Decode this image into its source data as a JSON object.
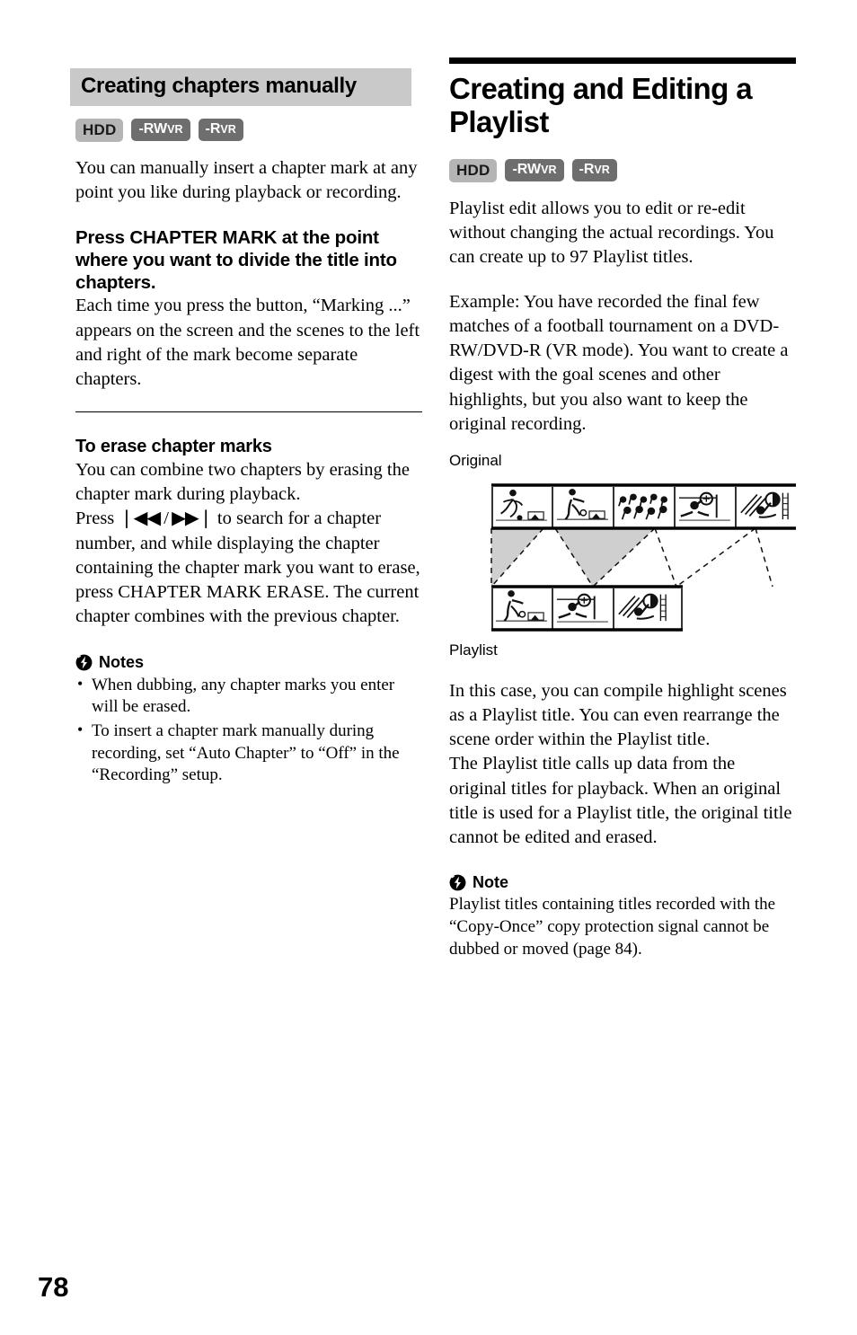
{
  "page": {
    "number": "78"
  },
  "left_column": {
    "section_heading": "Creating chapters manually",
    "badges": [
      {
        "id": "hdd",
        "label": "HDD",
        "style": "light"
      },
      {
        "id": "rwvr",
        "main": "-RW",
        "sub": "VR",
        "style": "dark"
      },
      {
        "id": "rvr",
        "main": "-R",
        "sub": "VR",
        "style": "dark"
      }
    ],
    "intro": "You can manually insert a chapter mark at any point you like during playback or recording.",
    "step_heading": "Press CHAPTER MARK at the point where you want to divide the title into chapters.",
    "step_body": "Each time you press the button, “Marking ...” appears on the screen and the scenes to the left and right of the mark become separate chapters.",
    "erase_heading": "To erase chapter marks",
    "erase_body_1": "You can combine two chapters by erasing the chapter mark during playback.",
    "erase_body_2_prefix": "Press ",
    "erase_body_2_icons": "❘◀◀ / ▶▶❘",
    "erase_body_2_suffix": " to search for a chapter number, and while displaying the chapter containing the chapter mark you want to erase, press CHAPTER MARK ERASE. The current chapter combines with the previous chapter.",
    "notes_title": "Notes",
    "notes_icon": "warning-bolt-icon",
    "notes": [
      "When dubbing, any chapter marks you enter will be erased.",
      "To insert a chapter mark manually during recording, set “Auto Chapter” to “Off” in the “Recording” setup."
    ]
  },
  "right_column": {
    "main_heading": "Creating and Editing a Playlist",
    "badges": [
      {
        "id": "hdd",
        "label": "HDD",
        "style": "light"
      },
      {
        "id": "rwvr",
        "main": "-RW",
        "sub": "VR",
        "style": "dark"
      },
      {
        "id": "rvr",
        "main": "-R",
        "sub": "VR",
        "style": "dark"
      }
    ],
    "para_1": "Playlist edit allows you to edit or re-edit without changing the actual recordings. You can create up to 97 Playlist titles.",
    "para_2": "Example: You have recorded the final few matches of a football tournament on a DVD-RW/DVD-R (VR mode). You want to create a digest with the goal scenes and other highlights, but you also want to keep the original recording.",
    "figure": {
      "label_top": "Original",
      "label_bottom": "Playlist",
      "original_frames": [
        "player-running-scene",
        "player-kicking-ball-scene",
        "crowd-cheering-scene",
        "goalkeeper-save-scene",
        "goal-net-scene"
      ],
      "playlist_frames": [
        "player-kicking-ball-scene",
        "goalkeeper-save-scene",
        "goal-net-scene"
      ]
    },
    "para_3": "In this case, you can compile highlight scenes as a Playlist title. You can even rearrange the scene order within the Playlist title.",
    "para_4": "The Playlist title calls up data from the original titles for playback. When an original title is used for a Playlist title, the original title cannot be edited and erased.",
    "note_title": "Note",
    "note_icon": "warning-bolt-icon",
    "note_body": "Playlist titles containing titles recorded with the “Copy-Once” copy protection signal cannot be dubbed or moved (page 84)."
  }
}
